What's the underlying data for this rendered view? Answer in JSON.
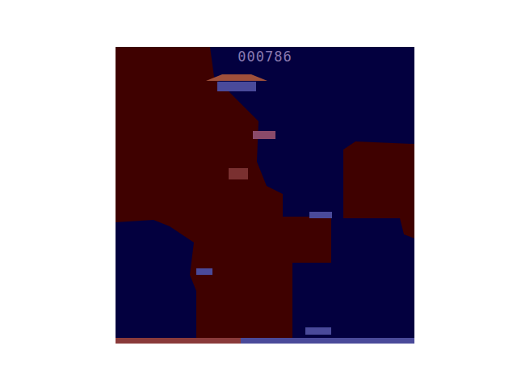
{
  "score": "000786",
  "fuel": {
    "level": 0.42
  }
}
